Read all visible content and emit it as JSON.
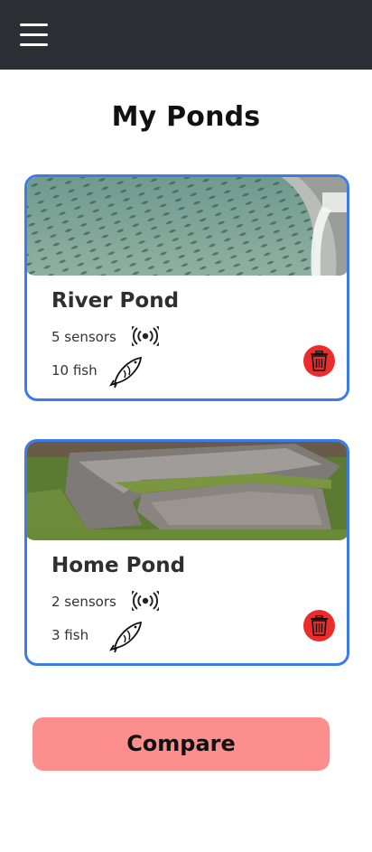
{
  "header": {
    "menu_icon": "hamburger-menu-icon"
  },
  "page": {
    "title": "My Ponds"
  },
  "ponds": [
    {
      "name": "River Pond",
      "sensors": "5 sensors",
      "fish": "10 fish",
      "image": "fish-farm-tank-photo",
      "sensor_icon": "radio-signal-icon",
      "fish_icon": "fish-icon",
      "delete_icon": "trash-icon"
    },
    {
      "name": "Home Pond",
      "sensors": "2 sensors",
      "fish": "3 fish",
      "image": "outdoor-pond-photo",
      "sensor_icon": "radio-signal-icon",
      "fish_icon": "fish-icon",
      "delete_icon": "trash-icon"
    }
  ],
  "actions": {
    "compare_label": "Compare"
  },
  "colors": {
    "topbar": "#2b2e33",
    "card_border": "#3b7ce8",
    "delete": "#ee2b2b",
    "compare": "#fc8e8e"
  }
}
